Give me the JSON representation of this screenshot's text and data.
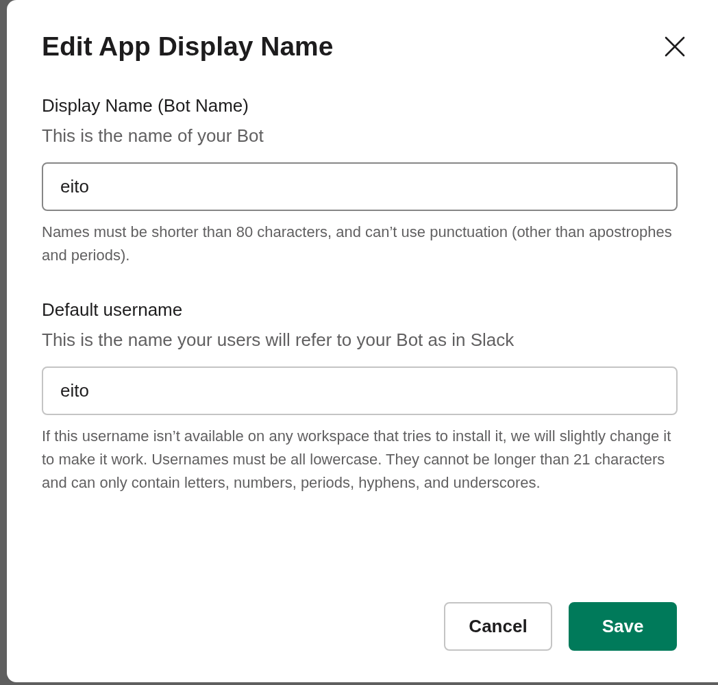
{
  "dialog": {
    "title": "Edit App Display Name",
    "fields": [
      {
        "label": "Display Name (Bot Name)",
        "description": "This is the name of your Bot",
        "value": "eito",
        "focused": true,
        "help": "Names must be shorter than 80 characters, and can’t use punctuation (other than apostrophes and periods)."
      },
      {
        "label": "Default username",
        "description": "This is the name your users will refer to your Bot as in Slack",
        "value": "eito",
        "focused": false,
        "help": "If this username isn’t available on any workspace that tries to install it, we will slightly change it to make it work. Usernames must be all lowercase. They cannot be longer than 21 characters and can only contain letters, numbers, periods, hyphens, and underscores."
      }
    ],
    "buttons": [
      {
        "label": "Cancel",
        "kind": "secondary"
      },
      {
        "label": "Save",
        "kind": "primary"
      }
    ]
  }
}
